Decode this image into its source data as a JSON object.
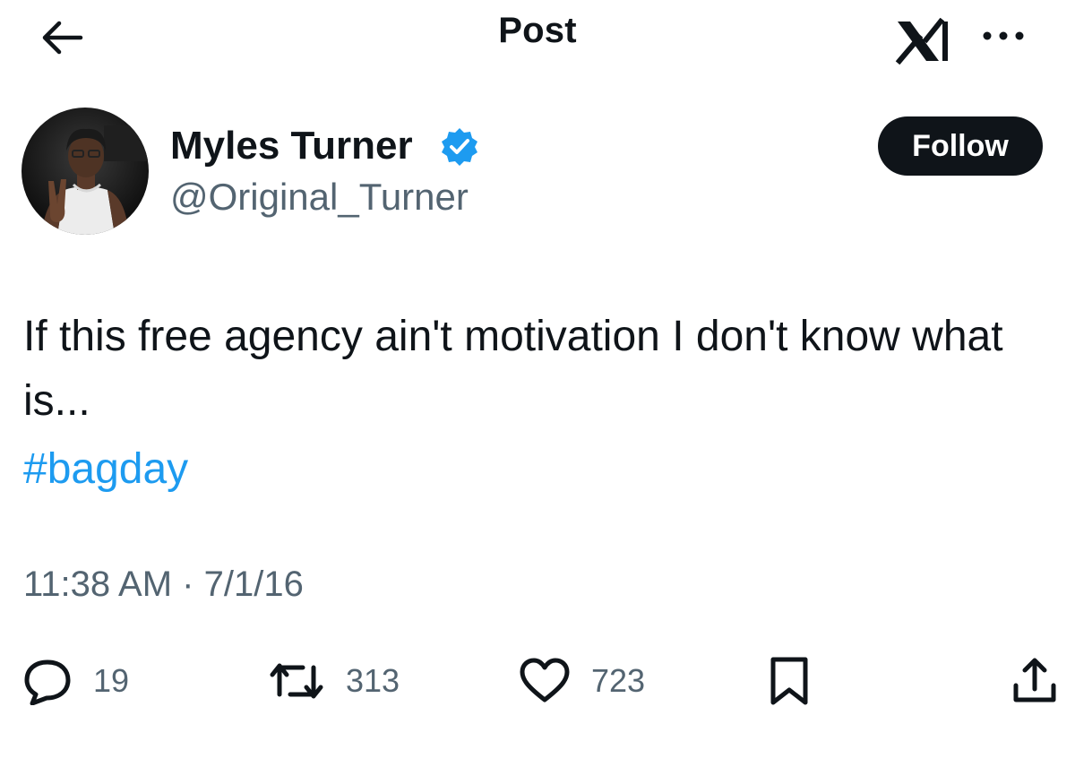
{
  "topbar": {
    "title": "Post",
    "back_icon": "back-arrow-icon",
    "logo_icon": "x-logo-icon",
    "more_icon": "more-horizontal-icon"
  },
  "author": {
    "name": "Myles Turner",
    "handle": "@Original_Turner",
    "verified": true,
    "verified_color": "#1d9bf0"
  },
  "follow_button": {
    "label": "Follow"
  },
  "post": {
    "text": "If this free agency ain't motivation I don't know what is...",
    "hashtag": "#bagday",
    "time": "11:38 AM",
    "separator": "·",
    "date": "7/1/16"
  },
  "actions": {
    "reply": {
      "icon": "reply-icon",
      "count": "19"
    },
    "repost": {
      "icon": "repost-icon",
      "count": "313"
    },
    "like": {
      "icon": "heart-icon",
      "count": "723"
    },
    "bookmark": {
      "icon": "bookmark-icon"
    },
    "share": {
      "icon": "share-icon"
    }
  },
  "colors": {
    "text": "#0f1419",
    "secondary": "#536471",
    "accent": "#1d9bf0"
  }
}
